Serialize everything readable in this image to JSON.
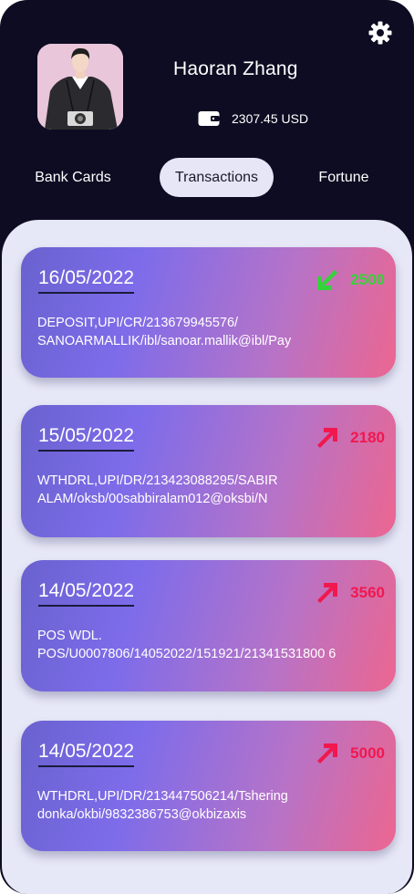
{
  "profile": {
    "name": "Haoran Zhang",
    "balance": "2307.45 USD"
  },
  "icons": {
    "settings": "gear-icon",
    "wallet": "wallet-icon",
    "incoming": "arrow-down-left-icon",
    "outgoing": "arrow-up-right-icon"
  },
  "tabs": [
    {
      "label": "Bank Cards"
    },
    {
      "label": "Transactions",
      "active": true
    },
    {
      "label": "Fortune"
    }
  ],
  "colors": {
    "background": "#0d0c22",
    "panel": "#e7e8f7",
    "incoming": "#35d33a",
    "outgoing": "#f0184f"
  },
  "transactions": [
    {
      "date": "16/05/2022",
      "description": "DEPOSIT,UPI/CR/213679945576/ SANOARMALLIK/ibl/sanoar.mallik@ibl/Pay",
      "amount": "2500",
      "direction": "incoming"
    },
    {
      "date": "15/05/2022",
      "description": "WTHDRL,UPI/DR/213423088295/SABIR ALAM/oksb/00sabbiralam012@oksbi/N",
      "amount": "2180",
      "direction": "outgoing"
    },
    {
      "date": "14/05/2022",
      "description": "POS WDL. POS/U0007806/14052022/151921/21341531800 6",
      "amount": "3560",
      "direction": "outgoing"
    },
    {
      "date": "14/05/2022",
      "description": "WTHDRL,UPI/DR/213447506214/Tshering donka/okbi/9832386753@okbizaxis",
      "amount": "5000",
      "direction": "outgoing"
    }
  ]
}
